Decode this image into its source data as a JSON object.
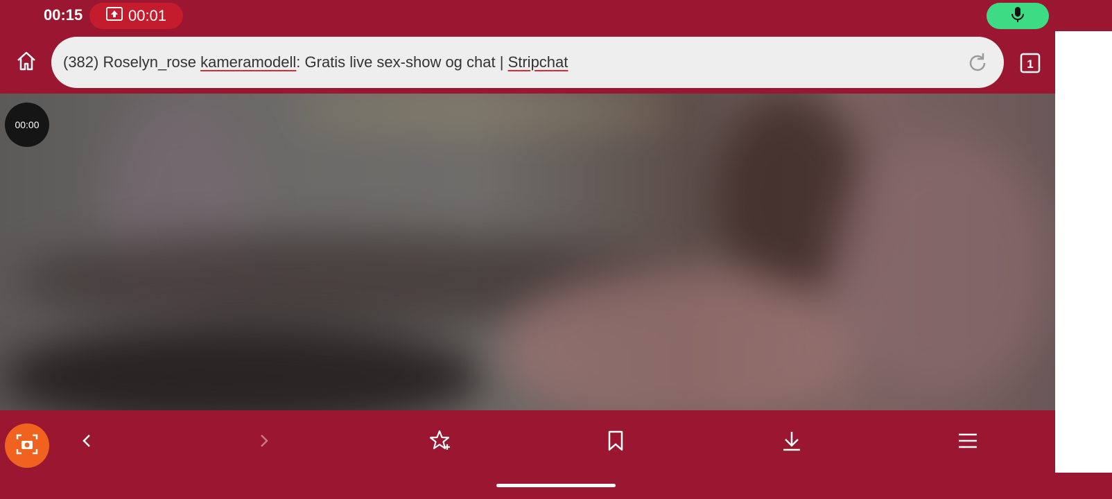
{
  "status_bar": {
    "time": "00:15",
    "recording_time": "00:01",
    "icons": [
      "screen-record-icon",
      "microphone-icon"
    ],
    "colors": {
      "record_pill": "#c41c2d",
      "mic_pill": "#3ddc84"
    }
  },
  "toolbar": {
    "url_parts": [
      {
        "text": "(382) Roselyn_rose ",
        "underline": false
      },
      {
        "text": "kameramodell",
        "underline": true
      },
      {
        "text": ": Gratis live sex-show og chat | ",
        "underline": false
      },
      {
        "text": "Stripchat",
        "underline": true
      }
    ],
    "tab_count": "1",
    "icons": [
      "home-icon",
      "reload-icon",
      "tabs-icon"
    ]
  },
  "video": {
    "elapsed": "00:00"
  },
  "bottom_nav": {
    "items": [
      "camera-icon",
      "back-icon",
      "forward-icon",
      "add-bookmark-icon",
      "bookmark-icon",
      "download-icon",
      "menu-icon"
    ]
  },
  "theme": {
    "brand": "#9b1731",
    "camera_button": "#f0621e"
  }
}
